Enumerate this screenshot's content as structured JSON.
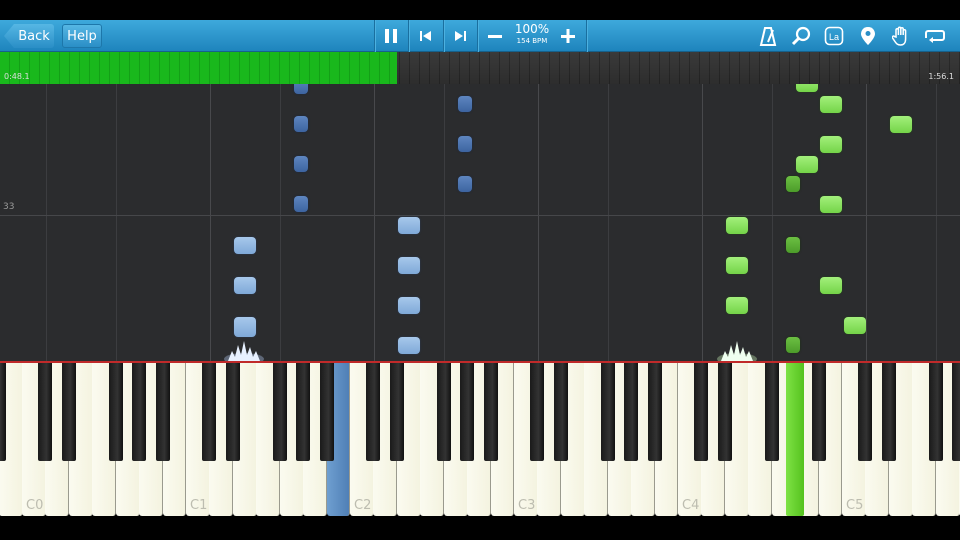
{
  "toolbar": {
    "back_label": "Back",
    "help_label": "Help",
    "speed_percent": "100%",
    "bpm": "154 BPM"
  },
  "progress": {
    "elapsed": "0:48.1",
    "total": "1:56.1",
    "fraction": 0.414
  },
  "roll": {
    "measure_label": "33"
  },
  "keyboard": {
    "octave_labels": [
      "C0",
      "C1",
      "C2",
      "C3",
      "C4",
      "C5"
    ],
    "pressed_keys": [
      "B1",
      "G#4"
    ]
  },
  "colors": {
    "toolbar": "#1e84bd",
    "progress_fill": "#19b81c",
    "left_hand": "#4f7fb6",
    "right_hand": "#74d448"
  },
  "icons": [
    "back-arrow-icon",
    "pause-icon",
    "skip-back-icon",
    "skip-forward-icon",
    "minus-icon",
    "plus-icon",
    "metronome-icon",
    "magnifier-icon",
    "note-name-icon",
    "location-pin-icon",
    "hand-icon",
    "loop-icon"
  ]
}
